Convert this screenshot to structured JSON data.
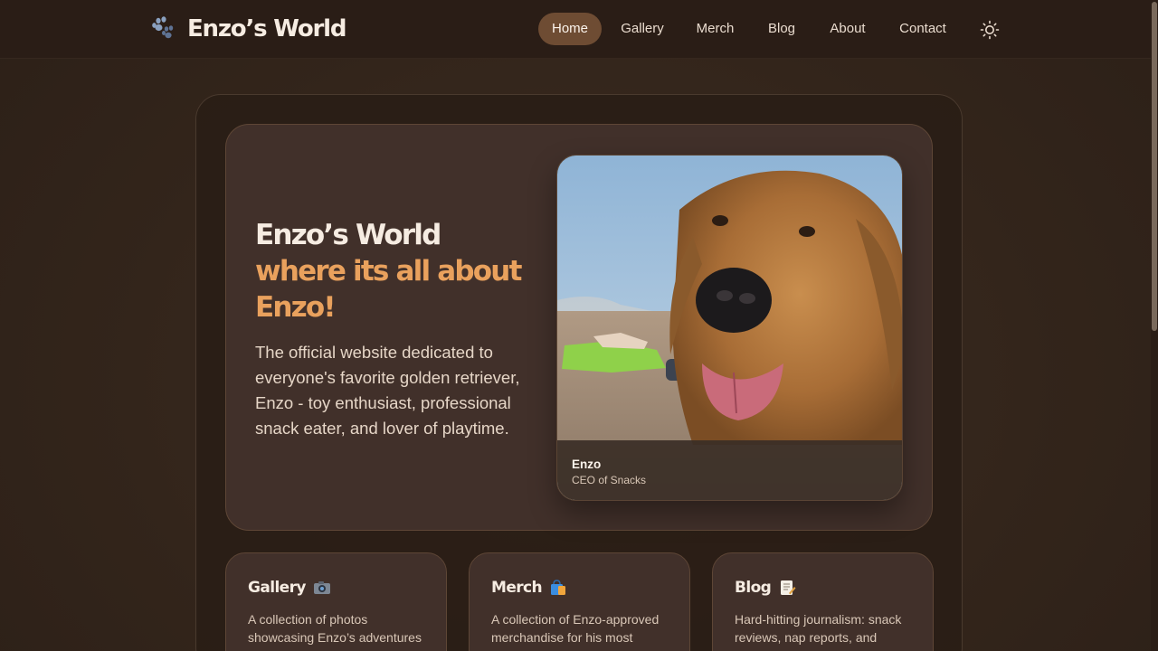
{
  "brand": {
    "title": "Enzo’s World",
    "icon": "paw-icon"
  },
  "nav": {
    "items": [
      {
        "label": "Home",
        "active": true
      },
      {
        "label": "Gallery",
        "active": false
      },
      {
        "label": "Merch",
        "active": false
      },
      {
        "label": "Blog",
        "active": false
      },
      {
        "label": "About",
        "active": false
      },
      {
        "label": "Contact",
        "active": false
      }
    ],
    "theme_toggle_icon": "sun-icon"
  },
  "hero": {
    "title_line1": "Enzo’s World",
    "title_line2": "where its all about Enzo!",
    "description": "The official website dedicated to everyone's favorite golden retriever, Enzo - toy enthusiast, professional snack eater, and lover of playtime.",
    "photo": {
      "subject": "golden retriever on a beach",
      "caption_name": "Enzo",
      "caption_role": "CEO of Snacks"
    }
  },
  "cards": [
    {
      "title": "Gallery",
      "icon": "camera-icon",
      "description": "A collection of photos showcasing Enzo’s adventures and mischievous moments."
    },
    {
      "title": "Merch",
      "icon": "shopping-bag-icon",
      "description": "A collection of Enzo-approved merchandise for his most devoted fans."
    },
    {
      "title": "Blog",
      "icon": "memo-icon",
      "description": "Hard-hitting journalism: snack reviews, nap reports, and squirrel updates."
    }
  ],
  "colors": {
    "accent": "#e9a15d",
    "nav_active_bg": "#6e4c33",
    "background": "#33251b",
    "card_bg": "#41302a"
  }
}
